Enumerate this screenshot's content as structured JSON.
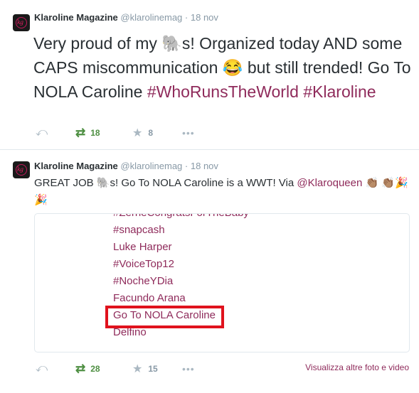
{
  "tweets": [
    {
      "name": "Klaroline Magazine",
      "handle": "@klarolinemag",
      "dot": "·",
      "time": "18 nov",
      "avatar_letters": "kg",
      "text_before": "Very proud of my ",
      "emoji_1": "🐘",
      "text_mid": "s! Organized today AND some CAPS miscommunication ",
      "emoji_2": "😂",
      "text_after": " but still trended! Go To NOLA Caroline ",
      "hashtags": [
        "#WhoRunsTheWorld",
        "#Klaroline"
      ],
      "retweets": "18",
      "favorites": "8"
    },
    {
      "name": "Klaroline Magazine",
      "handle": "@klarolinemag",
      "dot": "·",
      "time": "18 nov",
      "avatar_letters": "kg",
      "text_before": "GREAT JOB ",
      "emoji_1": "🐘",
      "text_mid": "s! Go To NOLA Caroline is a WWT! Via ",
      "mention": "@Klaroqueen",
      "emoji_tail": " 👏🏽 👏🏽🎉🎉",
      "retweets": "28",
      "favorites": "15",
      "media_link": "Visualizza altre foto e video"
    }
  ],
  "media_trends": [
    "#ZerneCongratsForTheBaby",
    "#snapcash",
    "Luke Harper",
    "#VoiceTop12",
    "#NocheYDia",
    "Facundo Arana",
    "Go To NOLA Caroline",
    "Delfino"
  ],
  "icons": {
    "reply": "reply-icon",
    "retweet": "retweet-icon",
    "favorite": "star-icon",
    "more": "more-icon"
  },
  "colors": {
    "link": "#8f2b5b",
    "retweet_active": "#4e8f42",
    "highlight_box": "#e0121d"
  }
}
